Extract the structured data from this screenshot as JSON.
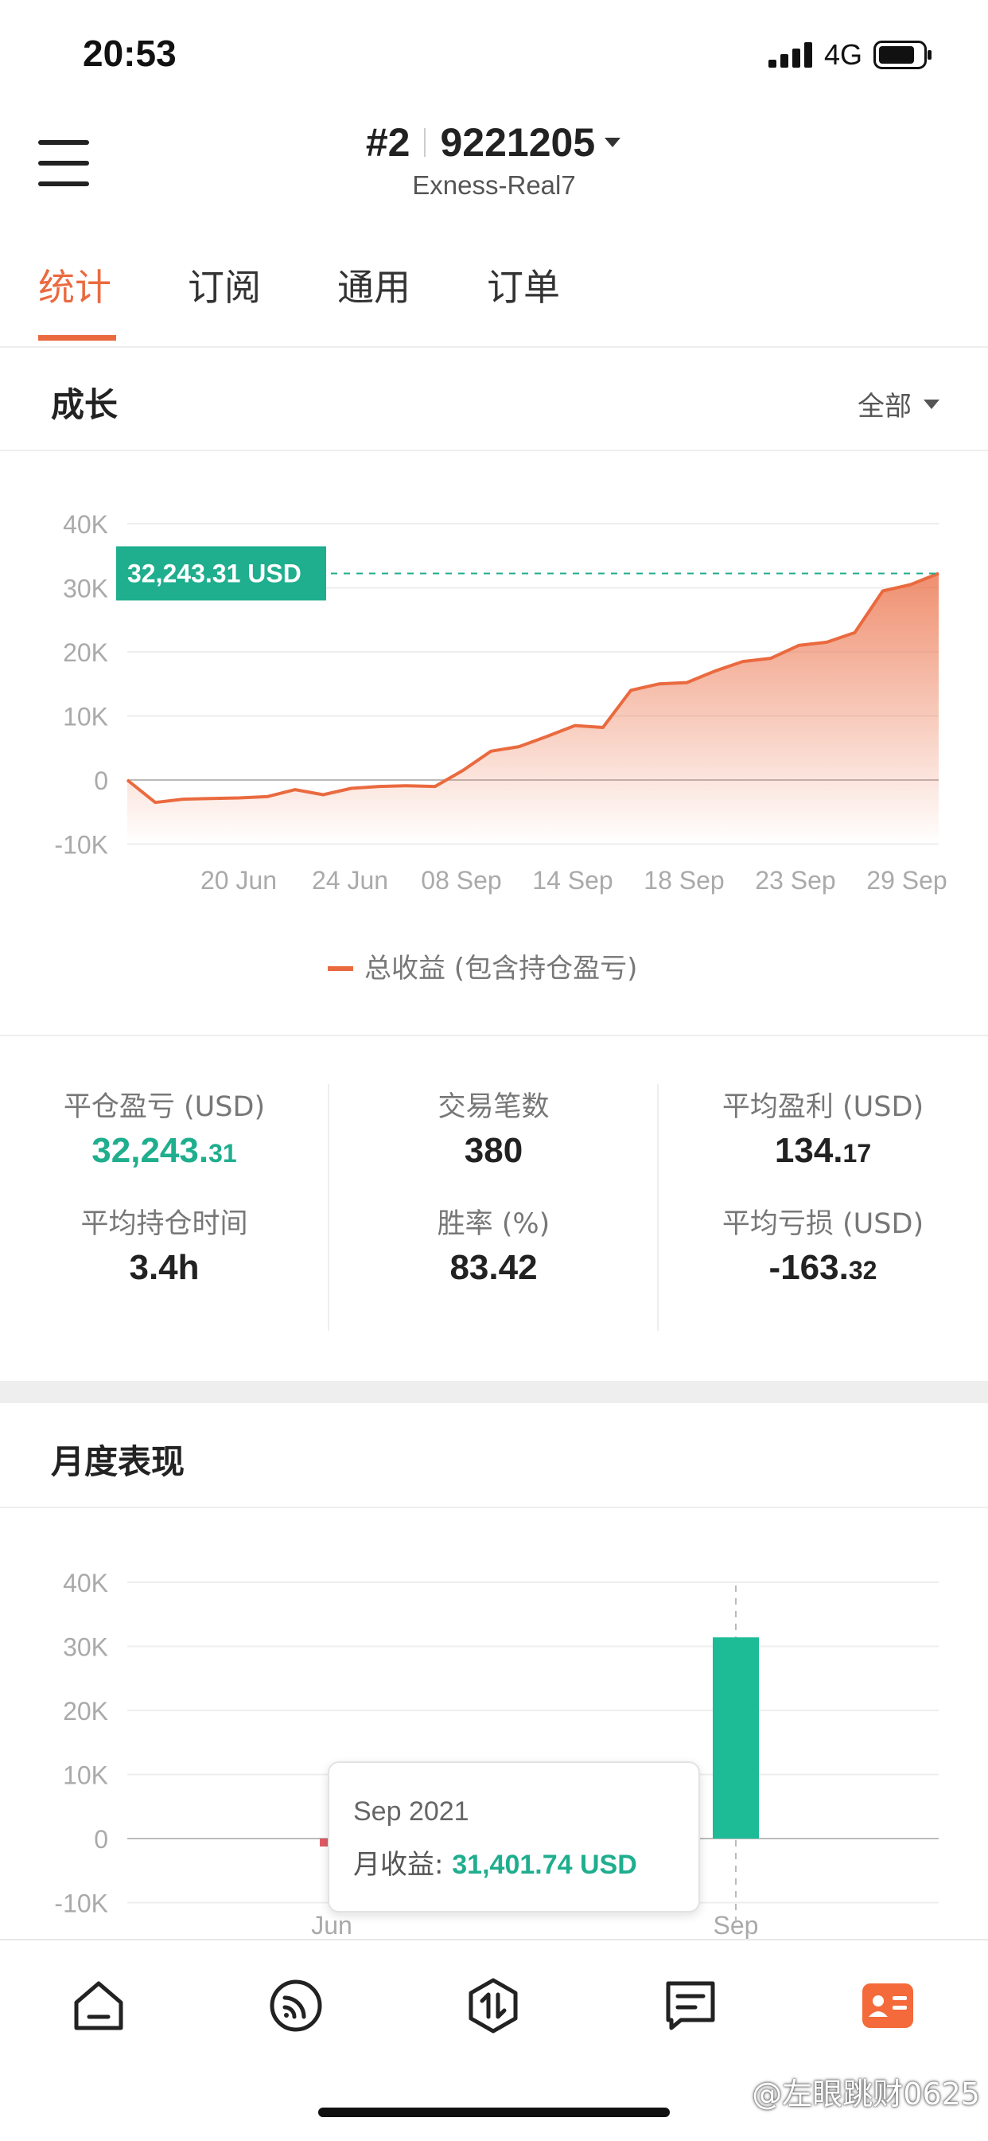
{
  "status_bar": {
    "time": "20:53",
    "network": "4G"
  },
  "header": {
    "rank": "#2",
    "account": "9221205",
    "server": "Exness-Real7"
  },
  "tabs": [
    {
      "label": "统计",
      "active": true
    },
    {
      "label": "订阅",
      "active": false
    },
    {
      "label": "通用",
      "active": false
    },
    {
      "label": "订单",
      "active": false
    }
  ],
  "growth": {
    "title": "成长",
    "range_label": "全部",
    "current_label": "32,243.31 USD",
    "legend": "总收益 (包含持仓盈亏)"
  },
  "stats": {
    "closed_pnl": {
      "label": "平仓盈亏 (USD)",
      "int": "32,243.",
      "dec": "31"
    },
    "trades": {
      "label": "交易笔数",
      "value": "380"
    },
    "avg_profit": {
      "label": "平均盈利 (USD)",
      "int": "134.",
      "dec": "17"
    },
    "avg_hold": {
      "label": "平均持仓时间",
      "value": "3.4h"
    },
    "win_rate": {
      "label": "胜率 (%)",
      "value": "83.42"
    },
    "avg_loss": {
      "label": "平均亏损 (USD)",
      "int": "-163.",
      "dec": "32"
    }
  },
  "monthly": {
    "title": "月度表现",
    "tooltip_month": "Sep 2021",
    "tooltip_label": "月收益: ",
    "tooltip_value": "31,401.74 USD"
  },
  "chart_data": [
    {
      "type": "area",
      "title": "成长",
      "y_ticks": [
        "40K",
        "30K",
        "20K",
        "10K",
        "0",
        "-10K"
      ],
      "ylim": [
        -10000,
        40000
      ],
      "x_ticks": [
        "20 Jun",
        "24 Jun",
        "08 Sep",
        "14 Sep",
        "18 Sep",
        "23 Sep",
        "29 Sep"
      ],
      "series": [
        {
          "name": "总收益 (包含持仓盈亏)",
          "values": [
            0,
            -3500,
            -3000,
            -2900,
            -2800,
            -2600,
            -1500,
            -2300,
            -1300,
            -1000,
            -900,
            -1000,
            1500,
            4500,
            5200,
            6800,
            8500,
            8200,
            14000,
            15000,
            15200,
            17000,
            18500,
            19000,
            21000,
            21500,
            23000,
            29500,
            30500,
            32243.31
          ]
        }
      ],
      "color": "#ea6a3f",
      "grid": true
    },
    {
      "type": "bar",
      "title": "月度表现",
      "y_ticks": [
        "40K",
        "30K",
        "20K",
        "10K",
        "0",
        "-10K"
      ],
      "ylim": [
        -10000,
        40000
      ],
      "categories": [
        "Jun",
        "Sep"
      ],
      "values": [
        -1200,
        31401.74
      ],
      "colors": {
        "negative": "#e05a64",
        "positive": "#1dbc96"
      },
      "grid": true
    }
  ]
}
